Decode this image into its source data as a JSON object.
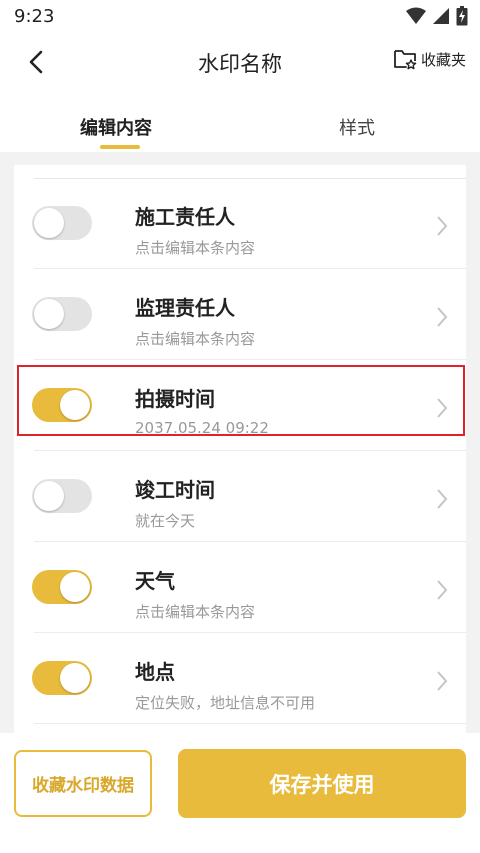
{
  "status_bar": {
    "time": "9:23",
    "icons": [
      "wifi-icon",
      "signal-icon",
      "battery-icon"
    ]
  },
  "header": {
    "back_icon": "back-arrow-icon",
    "title": "水印名称",
    "favorites_label": "收藏夹",
    "favorites_icon": "folder-star-icon"
  },
  "tabs": [
    {
      "label": "编辑内容",
      "active": true
    },
    {
      "label": "样式",
      "active": false
    }
  ],
  "items": [
    {
      "title": "施工责任人",
      "subtitle": "点击编辑本条内容",
      "enabled": false
    },
    {
      "title": "监理责任人",
      "subtitle": "点击编辑本条内容",
      "enabled": false
    },
    {
      "title": "拍摄时间",
      "subtitle": "2037.05.24 09:22",
      "enabled": true
    },
    {
      "title": "竣工时间",
      "subtitle": "就在今天",
      "enabled": false
    },
    {
      "title": "天气",
      "subtitle": "点击编辑本条内容",
      "enabled": true
    },
    {
      "title": "地点",
      "subtitle": "定位失败，地址信息不可用",
      "enabled": true
    }
  ],
  "footer": {
    "collect_label": "收藏水印数据",
    "save_label": "保存并使用"
  },
  "colors": {
    "accent": "#e8bb3c",
    "highlight": "#e0222c",
    "toggle_off": "#e3e3e3"
  }
}
